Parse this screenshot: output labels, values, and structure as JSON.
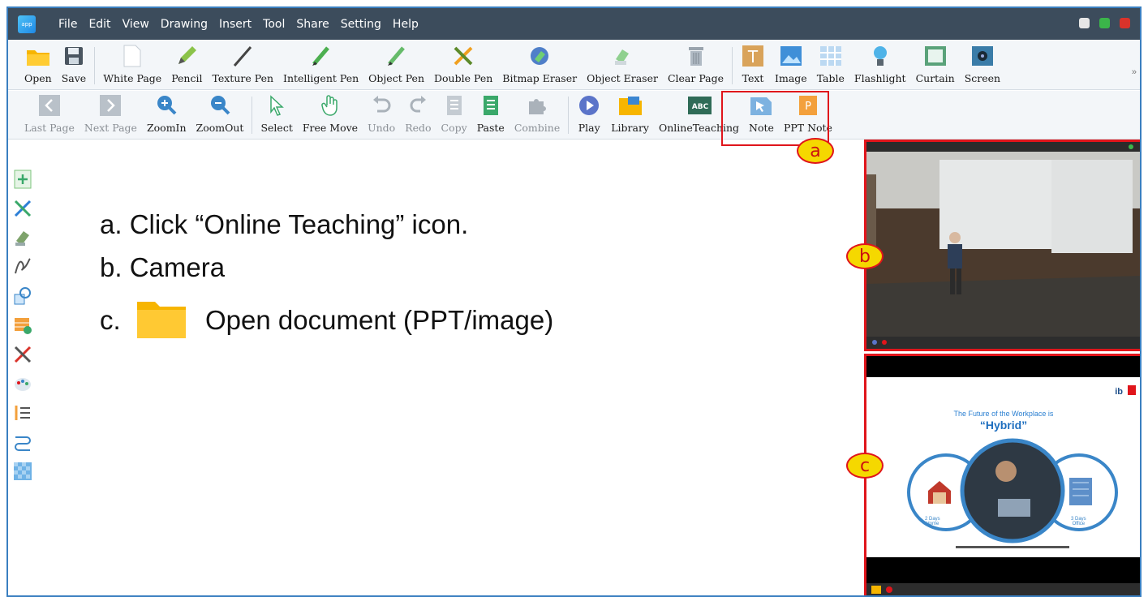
{
  "menu": [
    "File",
    "Edit",
    "View",
    "Drawing",
    "Insert",
    "Tool",
    "Share",
    "Setting",
    "Help"
  ],
  "toolbar1": [
    {
      "label": "Open",
      "icon": "folder-icon"
    },
    {
      "label": "Save",
      "icon": "floppy-icon"
    },
    {
      "label": "White Page",
      "icon": "white-page-icon"
    },
    {
      "label": "Pencil",
      "icon": "pencil-icon"
    },
    {
      "label": "Texture Pen",
      "icon": "texture-pen-icon"
    },
    {
      "label": "Intelligent Pen",
      "icon": "intelligent-pen-icon"
    },
    {
      "label": "Object Pen",
      "icon": "object-pen-icon"
    },
    {
      "label": "Double Pen",
      "icon": "double-pen-icon"
    },
    {
      "label": "Bitmap Eraser",
      "icon": "bitmap-eraser-icon"
    },
    {
      "label": "Object Eraser",
      "icon": "object-eraser-icon"
    },
    {
      "label": "Clear Page",
      "icon": "trash-icon"
    },
    {
      "label": "Text",
      "icon": "text-icon"
    },
    {
      "label": "Image",
      "icon": "image-icon"
    },
    {
      "label": "Table",
      "icon": "table-icon"
    },
    {
      "label": "Flashlight",
      "icon": "flashlight-icon"
    },
    {
      "label": "Curtain",
      "icon": "curtain-icon"
    },
    {
      "label": "Screen",
      "icon": "screen-icon"
    }
  ],
  "toolbar2": [
    {
      "label": "Last Page",
      "icon": "chevron-left-icon",
      "disabled": true
    },
    {
      "label": "Next Page",
      "icon": "chevron-right-icon",
      "disabled": true
    },
    {
      "label": "ZoomIn",
      "icon": "zoom-in-icon"
    },
    {
      "label": "ZoomOut",
      "icon": "zoom-out-icon"
    },
    {
      "label": "Select",
      "icon": "cursor-icon"
    },
    {
      "label": "Free Move",
      "icon": "hand-icon"
    },
    {
      "label": "Undo",
      "icon": "undo-icon",
      "disabled": true
    },
    {
      "label": "Redo",
      "icon": "redo-icon",
      "disabled": true
    },
    {
      "label": "Copy",
      "icon": "copy-icon",
      "disabled": true
    },
    {
      "label": "Paste",
      "icon": "paste-icon"
    },
    {
      "label": "Combine",
      "icon": "puzzle-icon",
      "disabled": true
    },
    {
      "label": "Play",
      "icon": "play-icon"
    },
    {
      "label": "Library",
      "icon": "library-icon"
    },
    {
      "label": "OnlineTeaching",
      "icon": "abc-board-icon"
    },
    {
      "label": "Note",
      "icon": "note-icon"
    },
    {
      "label": "PPT Note",
      "icon": "ppt-icon"
    }
  ],
  "instructions": {
    "a": "a. Click “Online Teaching” icon.",
    "b": "b. Camera",
    "c_prefix": "c.",
    "c_text": "Open document (PPT/image)"
  },
  "callouts": {
    "a": "a",
    "b": "b",
    "c": "c"
  },
  "doc_slide": {
    "heading": "The Future of the Workplace is",
    "highlight": "“Hybrid”",
    "left_label": "2 Days\nHome",
    "right_label": "3 Days\nOffice",
    "logo_text": "ib"
  },
  "colors": {
    "accent": "#e0151b",
    "callout_fill": "#f5d800",
    "titlebar": "#3c4c5c"
  }
}
